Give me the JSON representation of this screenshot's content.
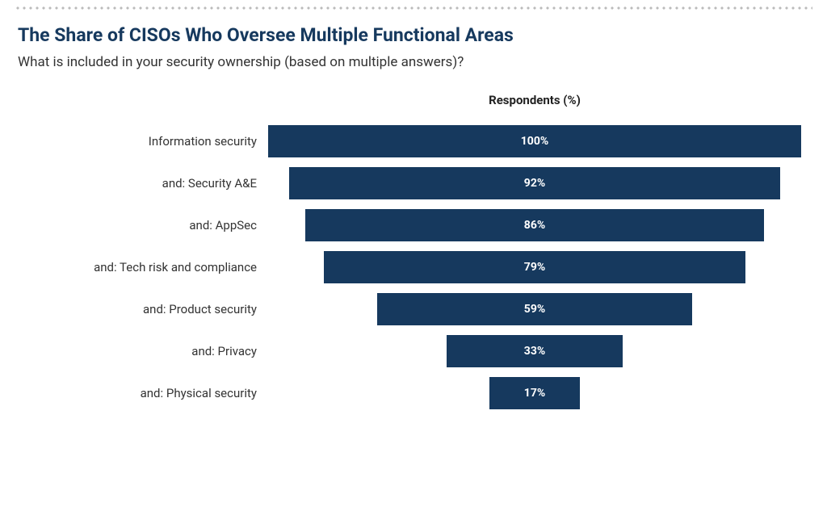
{
  "title": "The Share of CISOs Who Oversee Multiple Functional Areas",
  "subtitle": "What is included in your security ownership (based on multiple answers)?",
  "axis_label": "Respondents (%)",
  "chart_data": {
    "type": "bar",
    "orientation": "funnel-horizontal-centered",
    "categories": [
      "Information security",
      "and: Security A&E",
      "and: AppSec",
      "and: Tech risk and compliance",
      "and: Product security",
      "and: Privacy",
      "and: Physical security"
    ],
    "values": [
      100,
      92,
      86,
      79,
      59,
      33,
      17
    ],
    "value_suffix": "%",
    "xlabel": "Respondents (%)",
    "ylabel": "",
    "xlim": [
      0,
      100
    ],
    "bar_color": "#16395e"
  }
}
